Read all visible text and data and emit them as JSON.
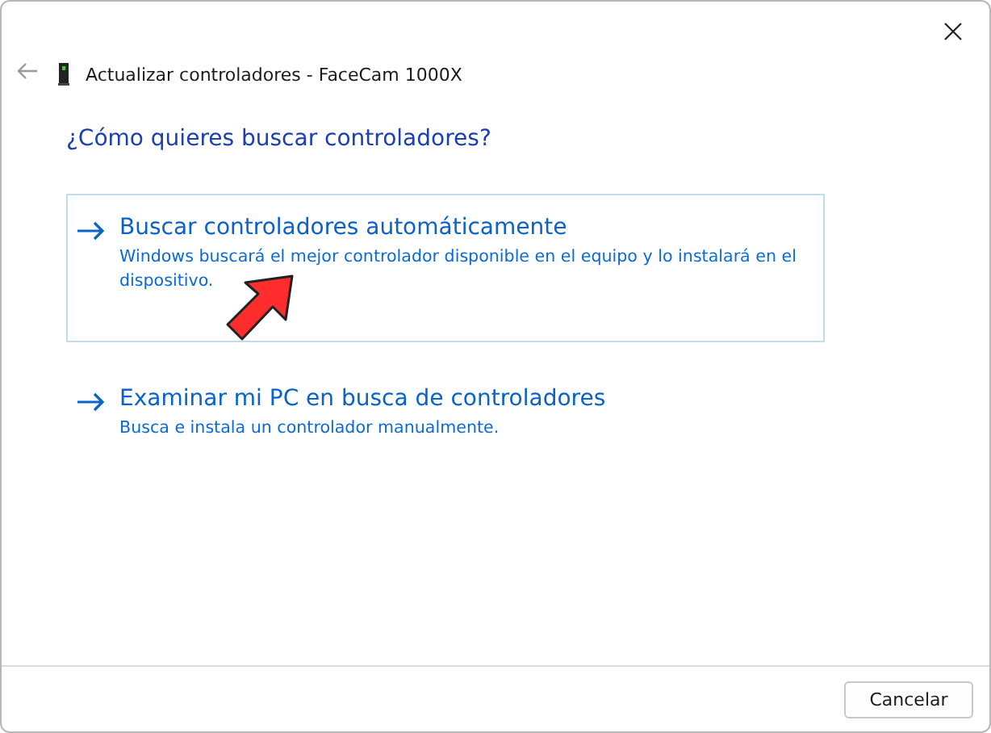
{
  "window": {
    "title": "Actualizar controladores - FaceCam 1000X"
  },
  "question": "¿Cómo quieres buscar controladores?",
  "options": [
    {
      "title": "Buscar controladores automáticamente",
      "description": "Windows buscará el mejor controlador disponible en el equipo y lo instalará en el dispositivo.",
      "selected": true,
      "pointer_arrow": true
    },
    {
      "title": "Examinar mi PC en busca de controladores",
      "description": "Busca e instala un controlador manualmente.",
      "selected": false,
      "pointer_arrow": false
    }
  ],
  "buttons": [
    "Cancelar"
  ]
}
